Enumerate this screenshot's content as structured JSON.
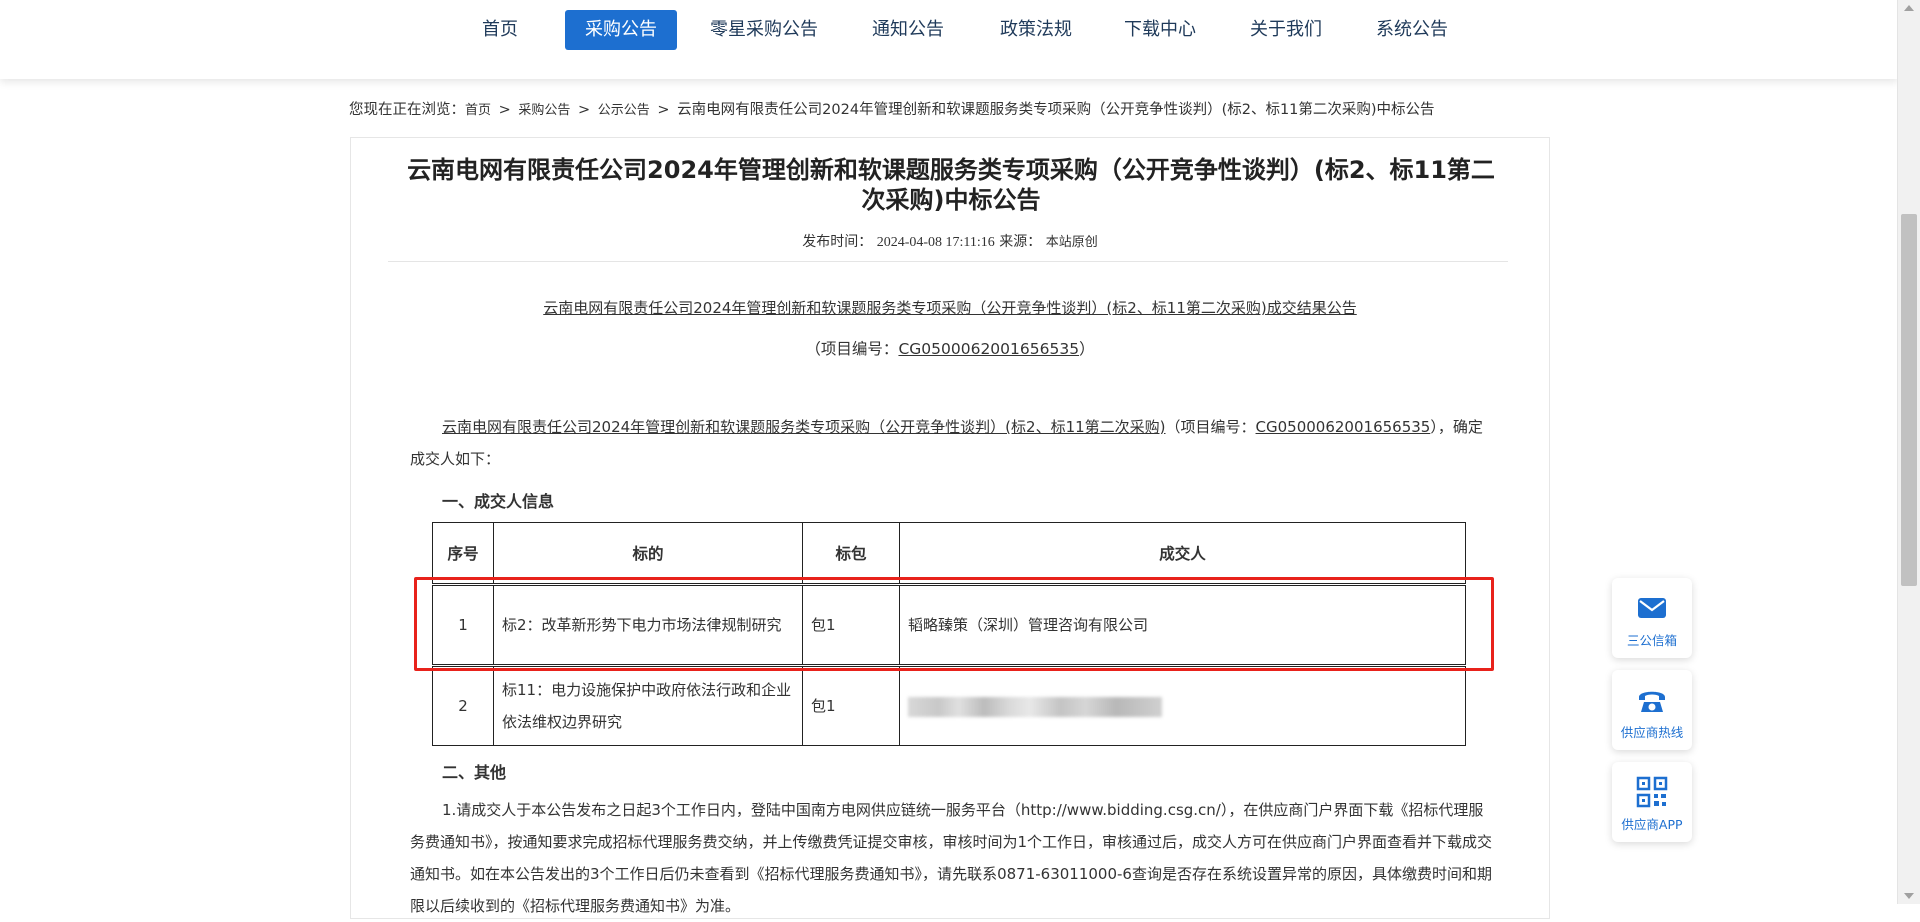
{
  "nav": {
    "items": [
      {
        "label": "首页",
        "active": false
      },
      {
        "label": "采购公告",
        "active": true
      },
      {
        "label": "零星采购公告",
        "active": false
      },
      {
        "label": "通知公告",
        "active": false
      },
      {
        "label": "政策法规",
        "active": false
      },
      {
        "label": "下载中心",
        "active": false
      },
      {
        "label": "关于我们",
        "active": false
      },
      {
        "label": "系统公告",
        "active": false
      }
    ]
  },
  "breadcrumb": {
    "prefix": "您现在正在浏览：",
    "home": "首页",
    "level1": "采购公告",
    "level2": "公示公告",
    "current": "云南电网有限责任公司2024年管理创新和软课题服务类专项采购（公开竞争性谈判）(标2、标11第二次采购)中标公告",
    "separator": ">"
  },
  "article": {
    "title": "云南电网有限责任公司2024年管理创新和软课题服务类专项采购（公开竞争性谈判）(标2、标11第二次采购)中标公告",
    "publish_label": "发布时间：",
    "publish_time": "2024-04-08 17:11:16",
    "source_label": "来源：",
    "source_value": "本站原创",
    "subheading": "云南电网有限责任公司2024年管理创新和软课题服务类专项采购（公开竞争性谈判）(标2、标11第二次采购)成交结果公告",
    "project_no_prefix": "（项目编号：",
    "project_no": "CG0500062001656535",
    "project_no_suffix": "）",
    "intro_link": "云南电网有限责任公司2024年管理创新和软课题服务类专项采购（公开竞争性谈判）(标2、标11第二次采购)",
    "intro_mid": "（项目编号：",
    "intro_projno": "CG0500062001656535",
    "intro_tail": "），确定成交人如下：",
    "section1": "一、成交人信息",
    "table": {
      "headers": [
        "序号",
        "标的",
        "标包",
        "成交人"
      ],
      "rows": [
        {
          "no": "1",
          "subject": "标2：改革新形势下电力市场法律规制研究",
          "package": "包1",
          "winner": "韬略臻策（深圳）管理咨询有限公司"
        },
        {
          "no": "2",
          "subject": "标11：电力设施保护中政府依法行政和企业依法维权边界研究",
          "package": "包1",
          "winner": ""
        }
      ]
    },
    "section2": "二、其他",
    "other_p1": "1.请成交人于本公告发布之日起3个工作日内，登陆中国南方电网供应链统一服务平台（http://www.bidding.csg.cn/），在供应商门户界面下载《招标代理服务费通知书》，按通知要求完成招标代理服务费交纳，并上传缴费凭证提交审核，审核时间为1个工作日，审核通过后，成交人方可在供应商门户界面查看并下载成交通知书。",
    "other_p1b": "如在本公告发出的3个工作日后仍未查看到《招标代理服务费通知书》，请先联系0871-63011000-6查询是否存在系统设置异常的原因，具体缴费时间和期限以后续收到的《招标代理服务费通知书》为准。"
  },
  "floating": [
    {
      "label": "三公信箱",
      "icon": "mail-icon"
    },
    {
      "label": "供应商热线",
      "icon": "phone-icon"
    },
    {
      "label": "供应商APP",
      "icon": "qrcode-icon"
    }
  ],
  "colors": {
    "accent": "#1d6fd0",
    "highlight": "#e8221b"
  }
}
